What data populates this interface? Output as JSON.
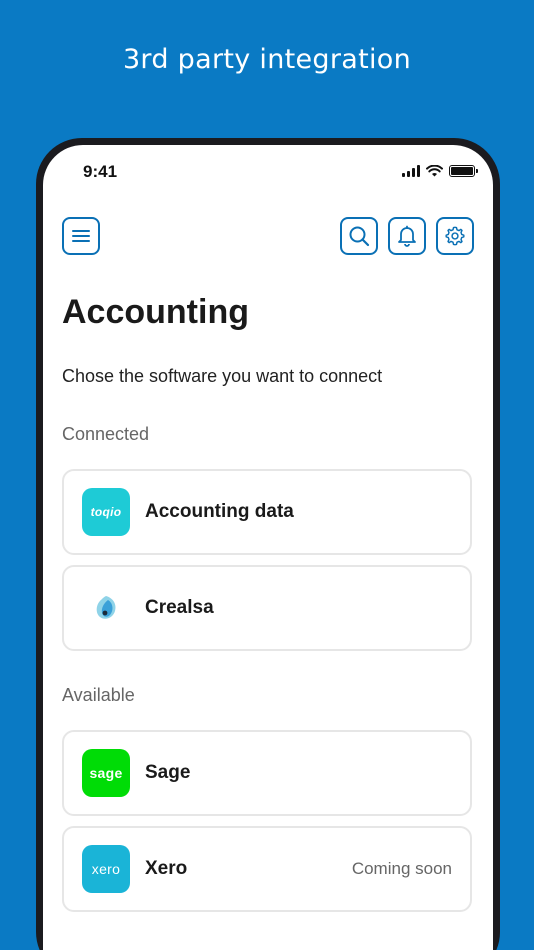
{
  "hero": {
    "title": "3rd party integration"
  },
  "status_bar": {
    "time": "9:41"
  },
  "header": {
    "icons": [
      "menu-icon",
      "search-icon",
      "bell-icon",
      "gear-icon"
    ]
  },
  "main": {
    "title": "Accounting",
    "subtitle": "Chose the software you want to connect",
    "connected_label": "Connected",
    "available_label": "Available",
    "connected": [
      {
        "name": "Accounting data",
        "logo_text": "toqio",
        "logo_color": "#1ecbd6"
      },
      {
        "name": "Crealsa",
        "logo_text": "",
        "logo_color": "#3aa0d8"
      }
    ],
    "available": [
      {
        "name": "Sage",
        "logo_text": "sage",
        "logo_color": "#00dc06",
        "badge": ""
      },
      {
        "name": "Xero",
        "logo_text": "xero",
        "logo_color": "#1ab4d7",
        "badge": "Coming soon"
      }
    ]
  },
  "colors": {
    "background": "#0a7ac4",
    "accent": "#0a70b5",
    "card_border": "#e6e6e6"
  }
}
